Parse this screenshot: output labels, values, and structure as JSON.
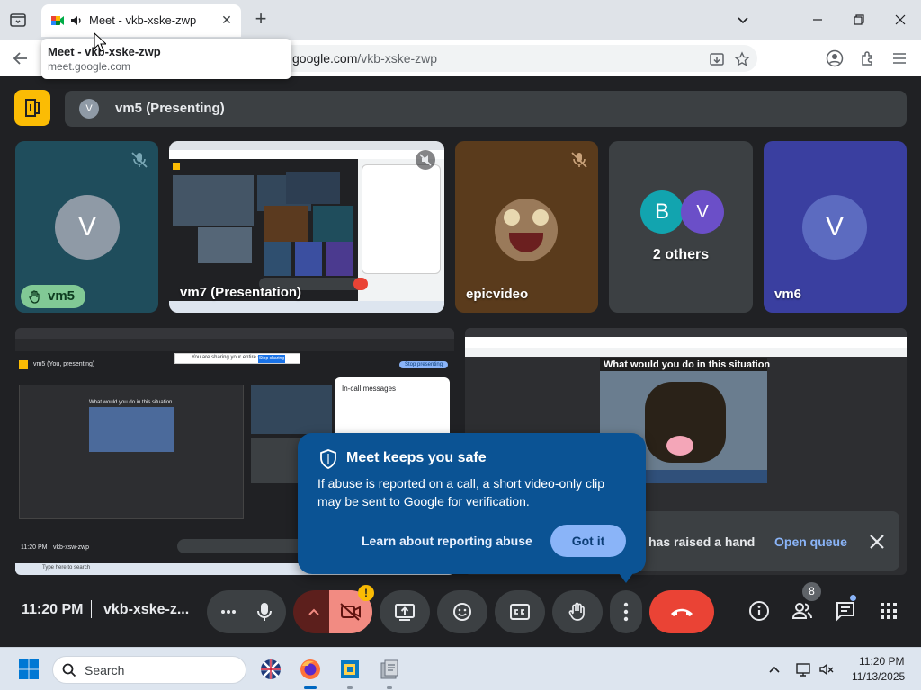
{
  "browser": {
    "tab_title": "Meet - vkb-xske-zwp",
    "url_host": "google.com",
    "url_path": "/vkb-xske-zwp",
    "tooltip": {
      "title": "Meet - vkb-xske-zwp",
      "url": "meet.google.com"
    }
  },
  "meet": {
    "presenting_avatar": "V",
    "presenting_label": "vm5 (Presenting)",
    "tiles": [
      {
        "name": "vm5",
        "avatar": "V",
        "hand_raised": true,
        "muted": true
      },
      {
        "name": "vm7 (Presentation)",
        "muted": true
      },
      {
        "name": "epicvideo",
        "muted": true
      },
      {
        "name": "2 others",
        "avatars": [
          "B",
          "V"
        ]
      },
      {
        "name": "vm6",
        "avatar": "V"
      }
    ],
    "share_left": {
      "presenting_bar": "vm5 (You, presenting)",
      "stop_btn": "Stop presenting",
      "chat_title": "In-call messages",
      "caption": "What would you do in this situation",
      "taskbar_time": "11:20 PM",
      "taskbar_code": "vkb-xsw-zwp",
      "taskbar_search": "Type here to search",
      "banner": "You are sharing your entire screen",
      "banner_btn": "Stop sharing"
    },
    "share_right": {
      "caption": "What would you do in this situation"
    },
    "safety_popup": {
      "title": "Meet keeps you safe",
      "body": "If abuse is reported on a call, a short video-only clip may be sent to Google for verification.",
      "link": "Learn about reporting abuse",
      "button": "Got it"
    },
    "raised_hand_bar": {
      "text": "has raised a hand",
      "action": "Open queue"
    },
    "controls": {
      "time": "11:20 PM",
      "code": "vkb-xske-z...",
      "people_count": "8",
      "camera_warning": "!"
    }
  },
  "taskbar": {
    "search_placeholder": "Search",
    "clock_time": "11:20 PM",
    "clock_date": "11/13/2025"
  },
  "colors": {
    "meet_bg": "#202124",
    "control_bg": "#3c4043",
    "hangup_red": "#ea4335",
    "camera_off": "#f28b82",
    "popup_blue": "#0b5394",
    "accent_blue": "#8ab4f8",
    "hand_green": "#81c995"
  }
}
